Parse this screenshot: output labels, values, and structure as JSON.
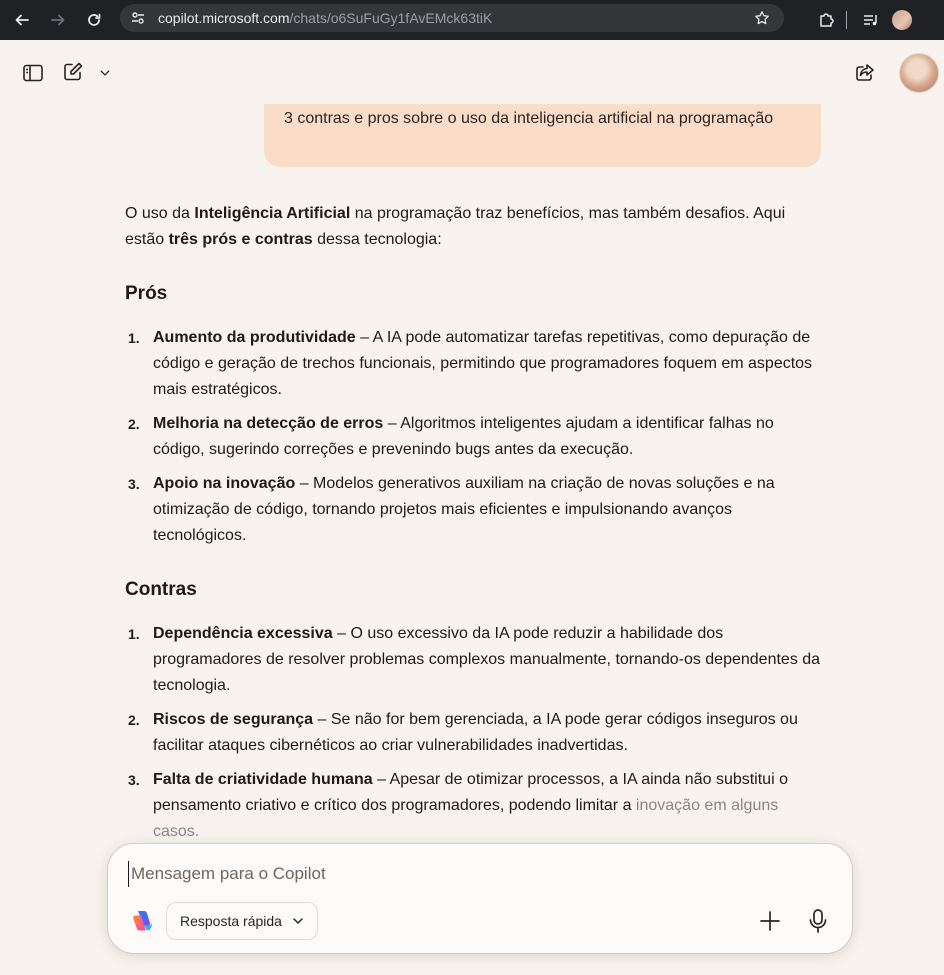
{
  "browser": {
    "url_host": "copilot.microsoft.com",
    "url_path": "/chats/o6SuFuGy1fAvEMck63tiK"
  },
  "conversation": {
    "user_message": "3 contras e pros sobre o uso da inteligencia artificial na programação",
    "answer": {
      "intro_1": "O uso da ",
      "intro_bold_1": "Inteligência Artificial",
      "intro_2": " na programação traz benefícios, mas também desafios. Aqui estão ",
      "intro_bold_2": "três prós e contras",
      "intro_3": " dessa tecnologia:",
      "pros_heading": "Prós",
      "pros": [
        {
          "num": "1.",
          "title": "Aumento da produtividade",
          "text": " – A IA pode automatizar tarefas repetitivas, como depuração de código e geração de trechos funcionais, permitindo que programadores foquem em aspectos mais estratégicos."
        },
        {
          "num": "2.",
          "title": "Melhoria na detecção de erros",
          "text": " – Algoritmos inteligentes ajudam a identificar falhas no código, sugerindo correções e prevenindo bugs antes da execução."
        },
        {
          "num": "3.",
          "title": "Apoio na inovação",
          "text": " – Modelos generativos auxiliam na criação de novas soluções e na otimização de código, tornando projetos mais eficientes e impulsionando avanços tecnológicos."
        }
      ],
      "cons_heading": "Contras",
      "cons": [
        {
          "num": "1.",
          "title": "Dependência excessiva",
          "text": " – O uso excessivo da IA pode reduzir a habilidade dos programadores de resolver problemas complexos manualmente, tornando-os dependentes da tecnologia."
        },
        {
          "num": "2.",
          "title": "Riscos de segurança",
          "text": " – Se não for bem gerenciada, a IA pode gerar códigos inseguros ou facilitar ataques cibernéticos ao criar vulnerabilidades inadvertidas."
        },
        {
          "num": "3.",
          "title": "Falta de criatividade humana",
          "text": " – Apesar de otimizar processos, a IA ainda não substitui o pensamento criativo e crítico dos programadores, podendo limitar a ",
          "faded": "inovação em alguns casos."
        }
      ]
    }
  },
  "composer": {
    "placeholder": "Mensagem para o Copilot",
    "mode_label": "Resposta rápida"
  },
  "icons": {
    "back": "arrow-left-icon",
    "forward": "arrow-right-icon",
    "reload": "reload-icon",
    "site_info": "tune-icon",
    "bookmark": "star-icon",
    "extensions": "puzzle-icon",
    "media": "media-queue-icon",
    "sidebar": "sidebar-icon",
    "new_chat": "compose-icon",
    "share": "share-icon",
    "add": "plus-icon",
    "mic": "microphone-icon"
  }
}
